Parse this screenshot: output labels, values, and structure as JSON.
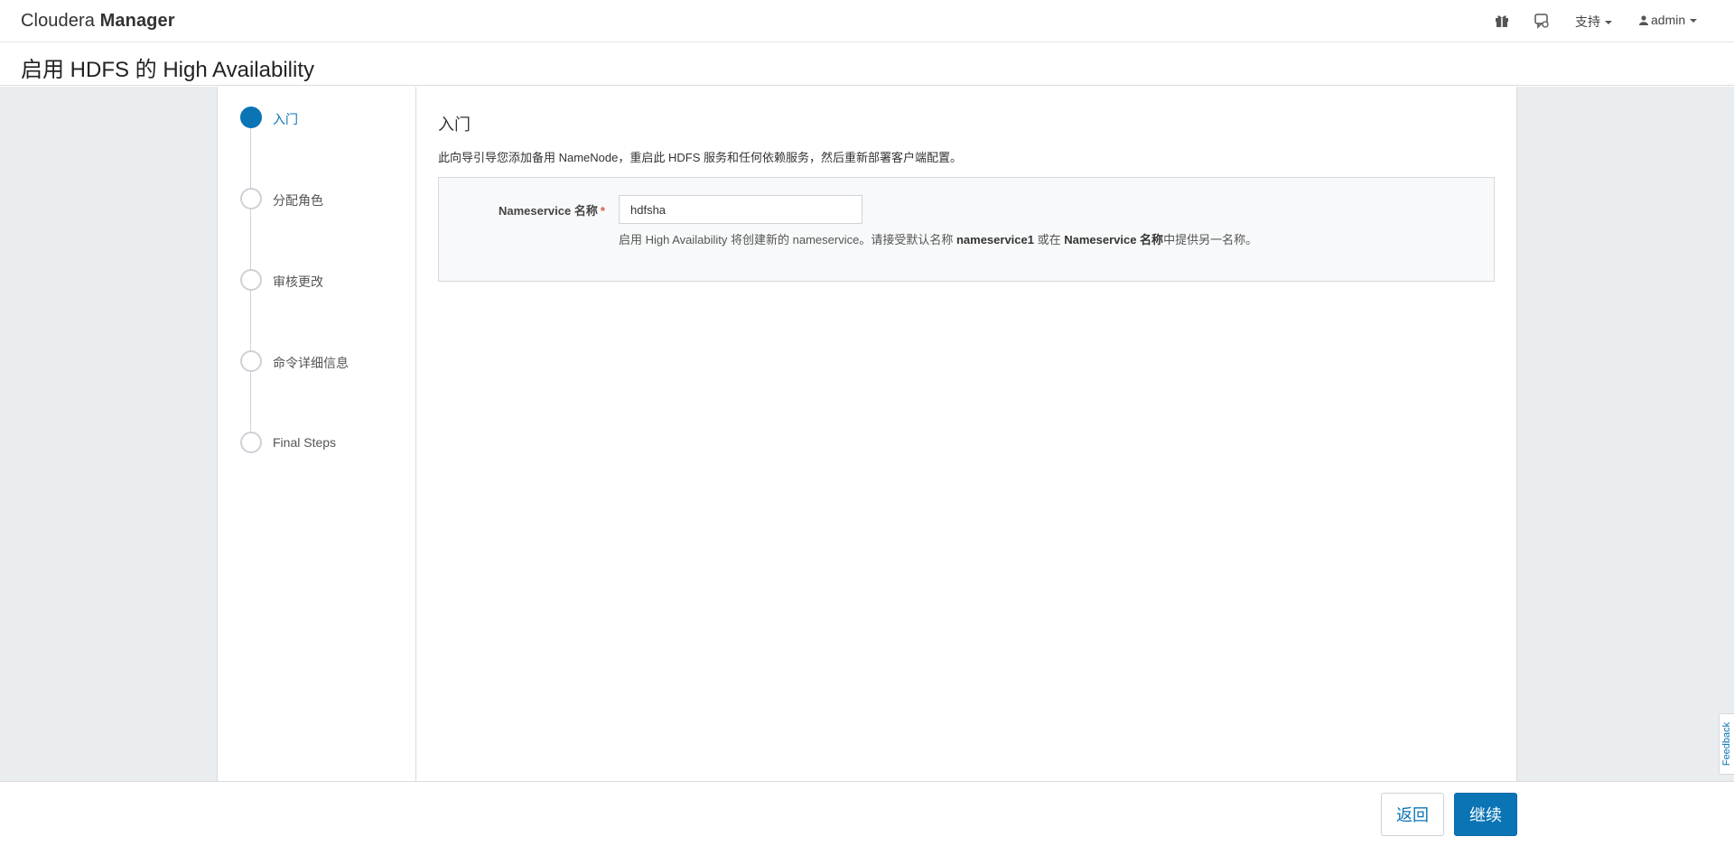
{
  "navbar": {
    "brand_light": "Cloudera",
    "brand_bold": "Manager",
    "support_label": "支持",
    "user_label": "admin",
    "icons": [
      "gift-icon",
      "chat-icon",
      "user-icon"
    ]
  },
  "page": {
    "title": "启用 HDFS 的 High Availability"
  },
  "steps": [
    {
      "label": "入门",
      "active": true
    },
    {
      "label": "分配角色",
      "active": false
    },
    {
      "label": "审核更改",
      "active": false
    },
    {
      "label": "命令详细信息",
      "active": false
    },
    {
      "label": "Final Steps",
      "active": false
    }
  ],
  "main": {
    "section_title": "入门",
    "intro": "此向导引导您添加备用 NameNode，重启此 HDFS 服务和任何依赖服务，然后重新部署客户端配置。",
    "field_label": "Nameservice 名称",
    "required_mark": "*",
    "field_value": "hdfsha",
    "help_prefix": "启用 High Availability 将创建新的 nameservice。请接受默认名称 ",
    "help_bold1": "nameservice1",
    "help_middle": " 或在 ",
    "help_bold2": "Nameservice 名称",
    "help_suffix": "中提供另一名称。"
  },
  "footer": {
    "back_label": "返回",
    "next_label": "继续"
  },
  "feedback_label": "Feedback",
  "colors": {
    "accent": "#0a74b5",
    "background": "#eaedf0",
    "required": "#d9534f"
  }
}
